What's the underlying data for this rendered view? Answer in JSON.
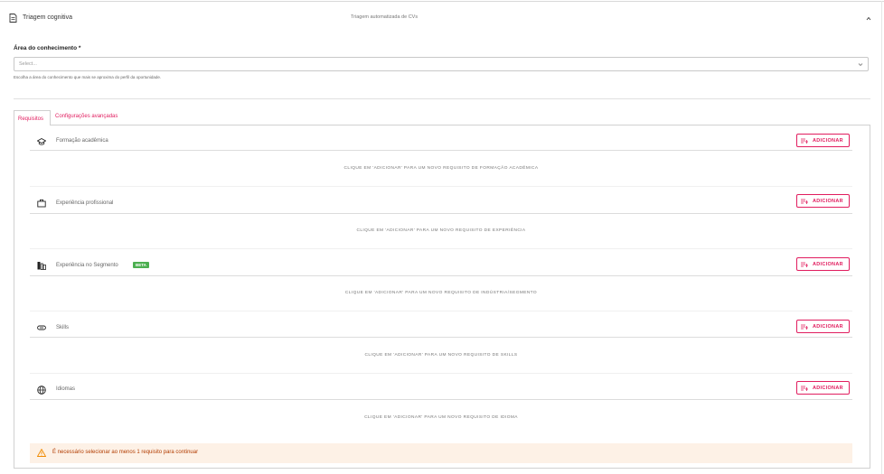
{
  "header": {
    "title": "Triagem cognitiva",
    "subtitle": "Triagem automatizada de CVs",
    "icon": "document-icon",
    "collapse_icon": "chevron-up-icon"
  },
  "area": {
    "label": "Área do conhecimento *",
    "placeholder": "Select...",
    "helper": "Escolha a área do conhecimento que mais se aproxima do perfil da oportunidade."
  },
  "tabs": [
    {
      "label": "Requisitos",
      "active": true
    },
    {
      "label": "Configurações avançadas",
      "active": false
    }
  ],
  "sections": [
    {
      "name": "Formação acadêmica",
      "icon": "graduation-cap-icon",
      "button": "ADICIONAR",
      "empty": "CLIQUE EM 'ADICIONAR' PARA UM NOVO REQUISITO DE FORMAÇÃO ACADÊMICA"
    },
    {
      "name": "Experiência profissional",
      "icon": "briefcase-icon",
      "button": "ADICIONAR",
      "empty": "CLIQUE EM 'ADICIONAR' PARA UM NOVO REQUISITO DE EXPERIÊNCIA"
    },
    {
      "name": "Experiência no Segmento",
      "icon": "building-icon",
      "button": "ADICIONAR",
      "badge": "BETA",
      "empty": "CLIQUE EM 'ADICIONAR' PARA UM NOVO REQUISITO DE INDÚSTRIA/SEGMENTO"
    },
    {
      "name": "Skills",
      "icon": "link-icon",
      "button": "ADICIONAR",
      "empty": "CLIQUE EM 'ADICIONAR' PARA UM NOVO REQUISITO DE SKILLS"
    },
    {
      "name": "Idiomas",
      "icon": "globe-icon",
      "button": "ADICIONAR",
      "empty": "CLIQUE EM 'ADICIONAR' PARA UM NOVO REQUISITO DE IDIOMA"
    }
  ],
  "alert": {
    "message": "É necessário selecionar ao menos 1 requisito para continuar",
    "icon": "warning-icon"
  },
  "colors": {
    "accent": "#e11d5f",
    "beta": "#4caf50",
    "alert_bg": "#fdf1e6",
    "alert_text": "#b23c00"
  }
}
